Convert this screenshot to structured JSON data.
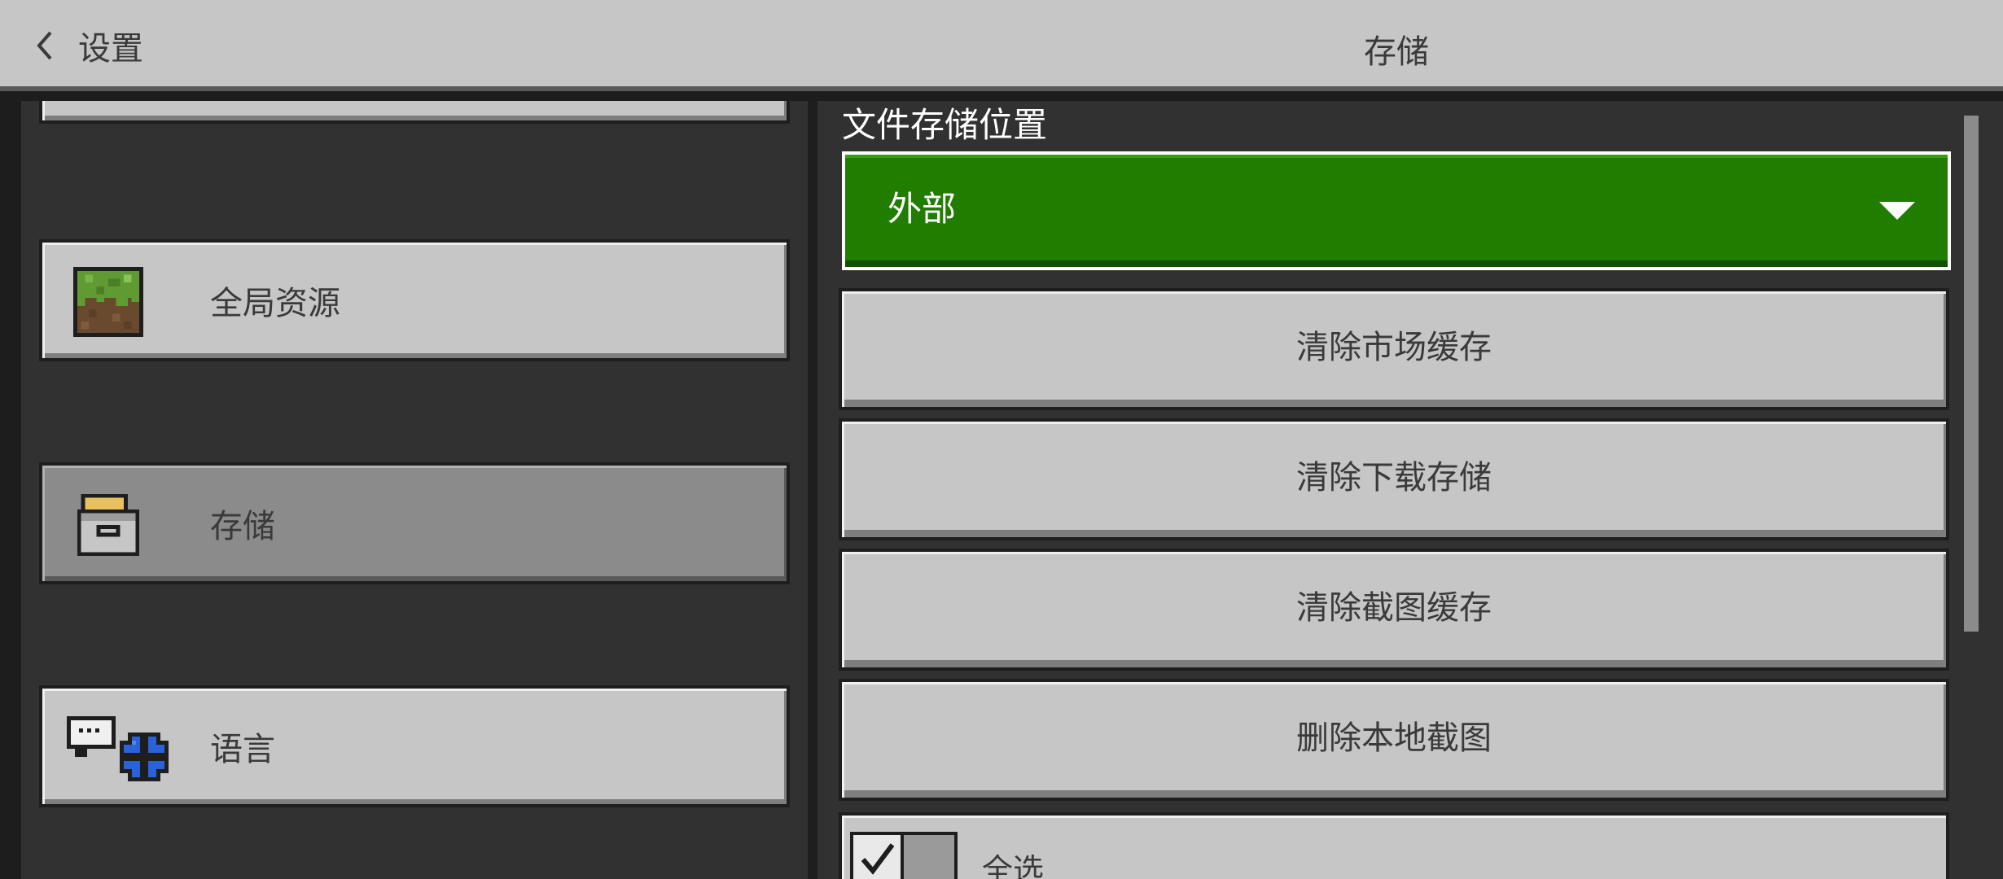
{
  "header": {
    "back_label": "设置",
    "title": "存储"
  },
  "sidebar": {
    "items": [
      {
        "label": "",
        "icon": "partial-card",
        "selected": false
      },
      {
        "label": "全局资源",
        "icon": "grass-block-icon",
        "selected": false
      },
      {
        "label": "存储",
        "icon": "storage-box-icon",
        "selected": true
      },
      {
        "label": "语言",
        "icon": "language-globe-icon",
        "selected": false
      }
    ]
  },
  "main": {
    "section_label": "文件存储位置",
    "dropdown": {
      "value": "外部",
      "color": "#217d00"
    },
    "buttons": [
      {
        "label": "清除市场缓存"
      },
      {
        "label": "清除下载存储"
      },
      {
        "label": "清除截图缓存"
      },
      {
        "label": "删除本地截图"
      }
    ],
    "checkbox": {
      "label": "全选",
      "checked": true
    }
  },
  "colors": {
    "header_bg": "#c6c6c6",
    "panel_bg": "#313131",
    "button_bg": "#c6c6c6",
    "button_selected_bg": "#8b8b8b",
    "accent_green": "#217d00"
  }
}
